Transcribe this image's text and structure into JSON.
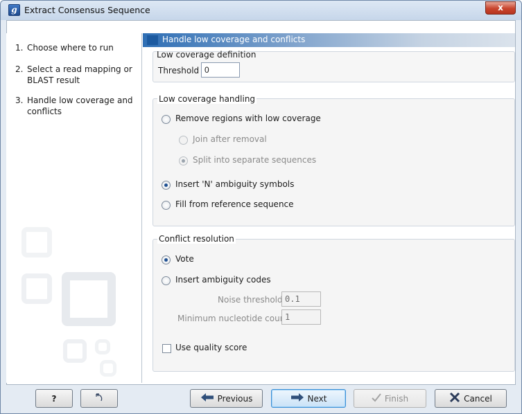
{
  "window": {
    "app_icon": "g",
    "title": "Extract Consensus Sequence",
    "close_label": "x"
  },
  "steps": [
    {
      "num": "1.",
      "label": "Choose where to run"
    },
    {
      "num": "2.",
      "label": "Select a read mapping or BLAST result"
    },
    {
      "num": "3.",
      "label": "Handle low coverage and conflicts"
    }
  ],
  "header": {
    "title": "Handle low coverage and conflicts"
  },
  "low_coverage_definition": {
    "title": "Low coverage definition",
    "threshold_label": "Threshold",
    "threshold_value": "0"
  },
  "low_coverage_handling": {
    "title": "Low coverage handling",
    "remove_label": "Remove regions with low coverage",
    "join_label": "Join after removal",
    "split_label": "Split into separate sequences",
    "insert_n_label": "Insert 'N' ambiguity symbols",
    "fill_label": "Fill from reference sequence",
    "selected": "Insert 'N' ambiguity symbols"
  },
  "conflict_resolution": {
    "title": "Conflict resolution",
    "vote_label": "Vote",
    "insert_codes_label": "Insert ambiguity codes",
    "noise_label": "Noise threshold",
    "noise_value": "0.1",
    "min_count_label": "Minimum nucleotide count",
    "min_count_value": "1",
    "quality_label": "Use quality score",
    "selected": "Vote"
  },
  "buttons": {
    "help": "?",
    "reset_icon": "reset-icon",
    "previous": "Previous",
    "next": "Next",
    "finish": "Finish",
    "cancel": "Cancel"
  },
  "colors": {
    "header_blue": "#2f6fb5",
    "close_red": "#c8442d",
    "focus_blue": "#3a8fd6"
  }
}
